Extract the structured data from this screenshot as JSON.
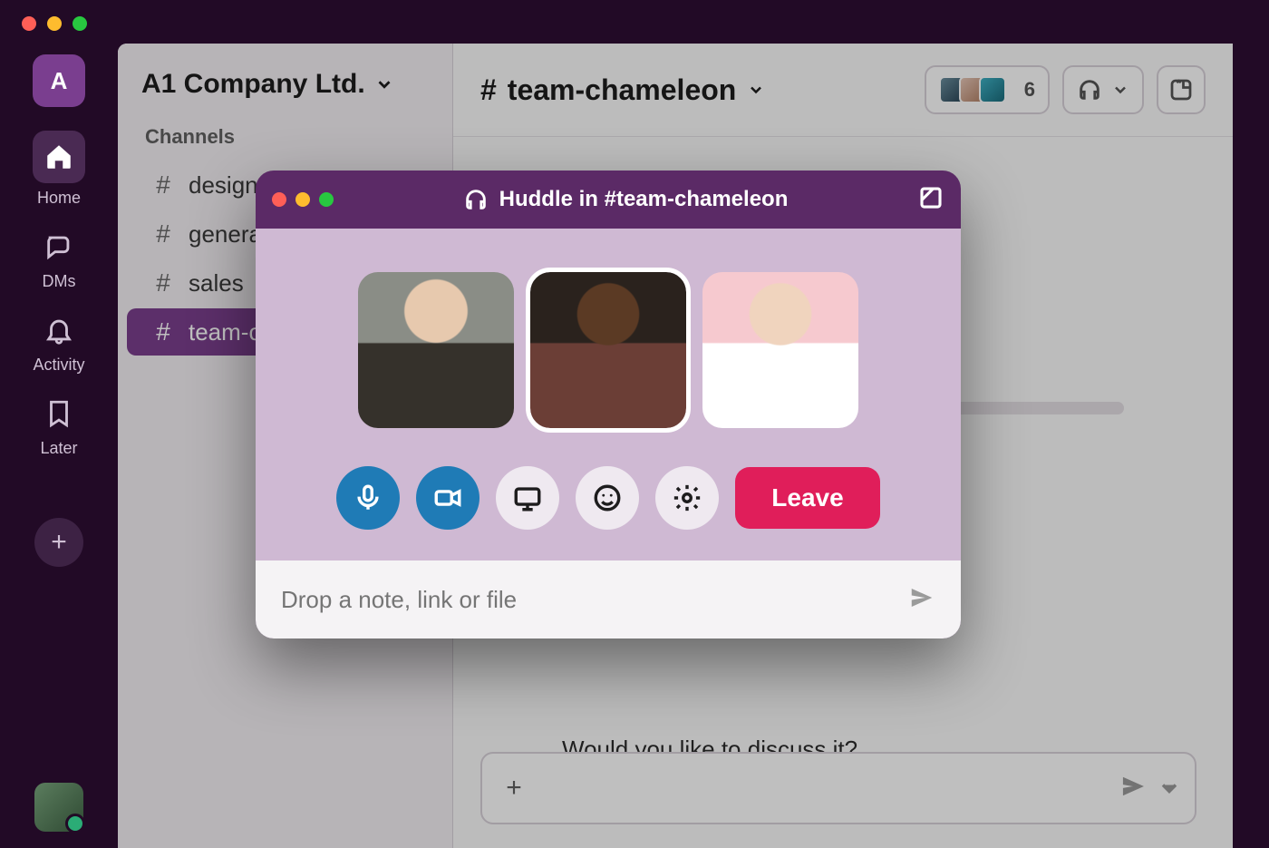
{
  "workspace": {
    "badge_letter": "A",
    "name": "A1 Company Ltd."
  },
  "rail": {
    "home": "Home",
    "dms": "DMs",
    "activity": "Activity",
    "later": "Later"
  },
  "sidebar": {
    "section_channels": "Channels",
    "channels": [
      {
        "name": "design",
        "active": false
      },
      {
        "name": "general",
        "active": false
      },
      {
        "name": "sales",
        "active": false
      },
      {
        "name": "team-chameleon",
        "active": true
      }
    ]
  },
  "channel": {
    "hash": "#",
    "name": "team-chameleon",
    "member_count": "6",
    "message_prompt": "Would you like to discuss it?"
  },
  "huddle": {
    "title": "Huddle in #team-chameleon",
    "note_placeholder": "Drop a note, link or file",
    "leave_label": "Leave",
    "participants": [
      {
        "id": "p1",
        "speaking": false
      },
      {
        "id": "p2",
        "speaking": true
      },
      {
        "id": "p3",
        "speaking": false
      }
    ],
    "controls": {
      "mic": "microphone-icon",
      "video": "video-icon",
      "screen": "screen-share-icon",
      "react": "emoji-icon",
      "settings": "gear-icon"
    }
  },
  "colors": {
    "brand_purple": "#5b2a66",
    "accent_pink": "#e01e5a",
    "accent_blue": "#1f7bb6"
  }
}
